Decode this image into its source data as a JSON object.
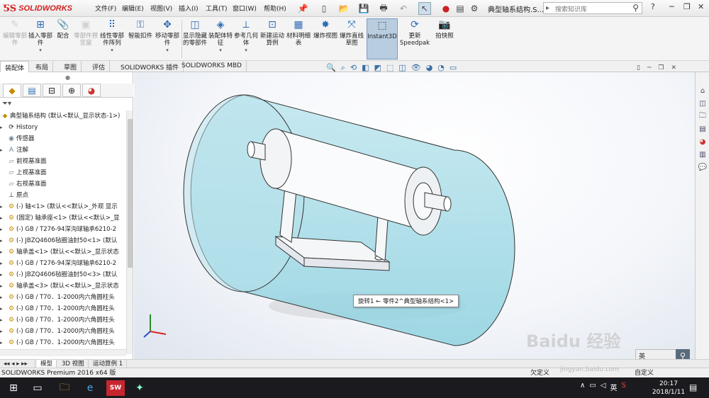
{
  "app": {
    "name": "SOLIDWORKS",
    "doc_title": "典型轴系结构.S..."
  },
  "menu": [
    "文件(F)",
    "编辑(E)",
    "视图(V)",
    "插入(I)",
    "工具(T)",
    "窗口(W)",
    "帮助(H)"
  ],
  "search": {
    "placeholder": "搜索知识库"
  },
  "ribbon": [
    {
      "label": "编辑零部件",
      "state": "disabled"
    },
    {
      "label": "插入零部件",
      "state": "normal"
    },
    {
      "label": "配合",
      "state": "normal"
    },
    {
      "label": "零部件预览窗",
      "state": "disabled"
    },
    {
      "label": "线性零部件阵列",
      "state": "normal"
    },
    {
      "label": "智能扣件",
      "state": "normal"
    },
    {
      "label": "移动零部件",
      "state": "normal"
    },
    {
      "label": "显示隐藏的零部件",
      "state": "normal"
    },
    {
      "label": "装配体特征",
      "state": "normal"
    },
    {
      "label": "参考几何体",
      "state": "normal"
    },
    {
      "label": "新建运动算例",
      "state": "normal"
    },
    {
      "label": "材料明细表",
      "state": "normal"
    },
    {
      "label": "爆炸视图",
      "state": "normal"
    },
    {
      "label": "爆炸直线草图",
      "state": "normal"
    },
    {
      "label": "Instant3D",
      "state": "active"
    },
    {
      "label": "更新Speedpak",
      "state": "normal"
    },
    {
      "label": "拍快照",
      "state": "normal"
    }
  ],
  "tabs": [
    "装配体",
    "布局",
    "草图",
    "评估",
    "SOLIDWORKS 插件",
    "SOLIDWORKS MBD"
  ],
  "tree": {
    "root": "典型轴系结构 (默认<默认_显示状态-1>)",
    "items": [
      {
        "label": "History",
        "icon": "history-icon"
      },
      {
        "label": "传感器",
        "icon": "sensor-icon"
      },
      {
        "label": "注解",
        "icon": "annotation-icon"
      },
      {
        "label": "前视基准面",
        "icon": "plane-icon"
      },
      {
        "label": "上视基准面",
        "icon": "plane-icon"
      },
      {
        "label": "右视基准面",
        "icon": "plane-icon"
      },
      {
        "label": "原点",
        "icon": "origin-icon"
      },
      {
        "label": "(-) 轴<1> (默认<<默认>_外观 显示",
        "icon": "part-icon"
      },
      {
        "label": "(固定) 轴承座<1> (默认<<默认>_显",
        "icon": "part-icon"
      },
      {
        "label": "(-) GB / T276-94深沟球轴承6210-2",
        "icon": "part-icon"
      },
      {
        "label": "(-) JBZQ4606毡圈油封50<1> (默认",
        "icon": "part-icon"
      },
      {
        "label": "轴承盖<1> (默认<<默认>_显示状态",
        "icon": "part-icon"
      },
      {
        "label": "(-) GB / T276-94深沟球轴承6210-2",
        "icon": "part-icon"
      },
      {
        "label": "(-) JBZQ4606毡圈油封50<3> (默认",
        "icon": "part-icon"
      },
      {
        "label": "轴承盖<3> (默认<<默认>_显示状态",
        "icon": "part-icon"
      },
      {
        "label": "(-) GB / T70．1-2000内六角圆柱头",
        "icon": "part-icon"
      },
      {
        "label": "(-) GB / T70．1-2000内六角圆柱头",
        "icon": "part-icon"
      },
      {
        "label": "(-) GB / T70．1-2000内六角圆柱头",
        "icon": "part-icon"
      },
      {
        "label": "(-) GB / T70．1-2000内六角圆柱头",
        "icon": "part-icon"
      },
      {
        "label": "(-) GB / T70．1-2000内六角圆柱头",
        "icon": "part-icon"
      }
    ]
  },
  "tooltip": "旋转1 ← 零件2^典型轴系结构<1>",
  "bottom_tabs": [
    "模型",
    "3D 视图",
    "运动算例 1"
  ],
  "status": {
    "left": "SOLIDWORKS Premium 2016 x64 版",
    "right": "欠定义",
    "edit": "自定义"
  },
  "viewbox": {
    "label": "英"
  },
  "taskbar": {
    "clock_time": "20:17",
    "clock_date": "2018/1/11",
    "ime": "英"
  },
  "watermark": {
    "main": "Baidu 经验",
    "sub": "jingyan.baidu.com"
  }
}
